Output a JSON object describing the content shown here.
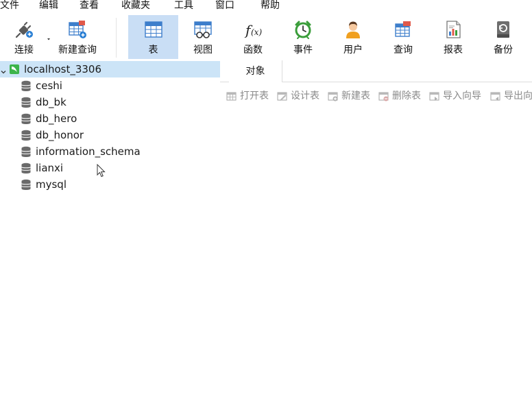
{
  "menu": {
    "items": [
      "文件",
      "编辑",
      "查看",
      "收藏夹",
      "工具",
      "窗口",
      "帮助"
    ]
  },
  "toolbar": {
    "connect": "连接",
    "new_query": "新建查询",
    "table": "表",
    "view": "视图",
    "function": "函数",
    "event": "事件",
    "user": "用户",
    "query": "查询",
    "report": "报表",
    "backup": "备份",
    "active": "表"
  },
  "tree": {
    "connection": "localhost_3306",
    "databases": [
      "ceshi",
      "db_bk",
      "db_hero",
      "db_honor",
      "information_schema",
      "lianxi",
      "mysql"
    ]
  },
  "objects_panel": {
    "tab": "对象",
    "actions": [
      "打开表",
      "设计表",
      "新建表",
      "删除表",
      "导入向导",
      "导出向"
    ]
  },
  "colors": {
    "selection": "#cce4f7",
    "active_tool": "#c9def5",
    "connection_green": "#3cb44b",
    "disabled_text": "#8a8a8a"
  }
}
